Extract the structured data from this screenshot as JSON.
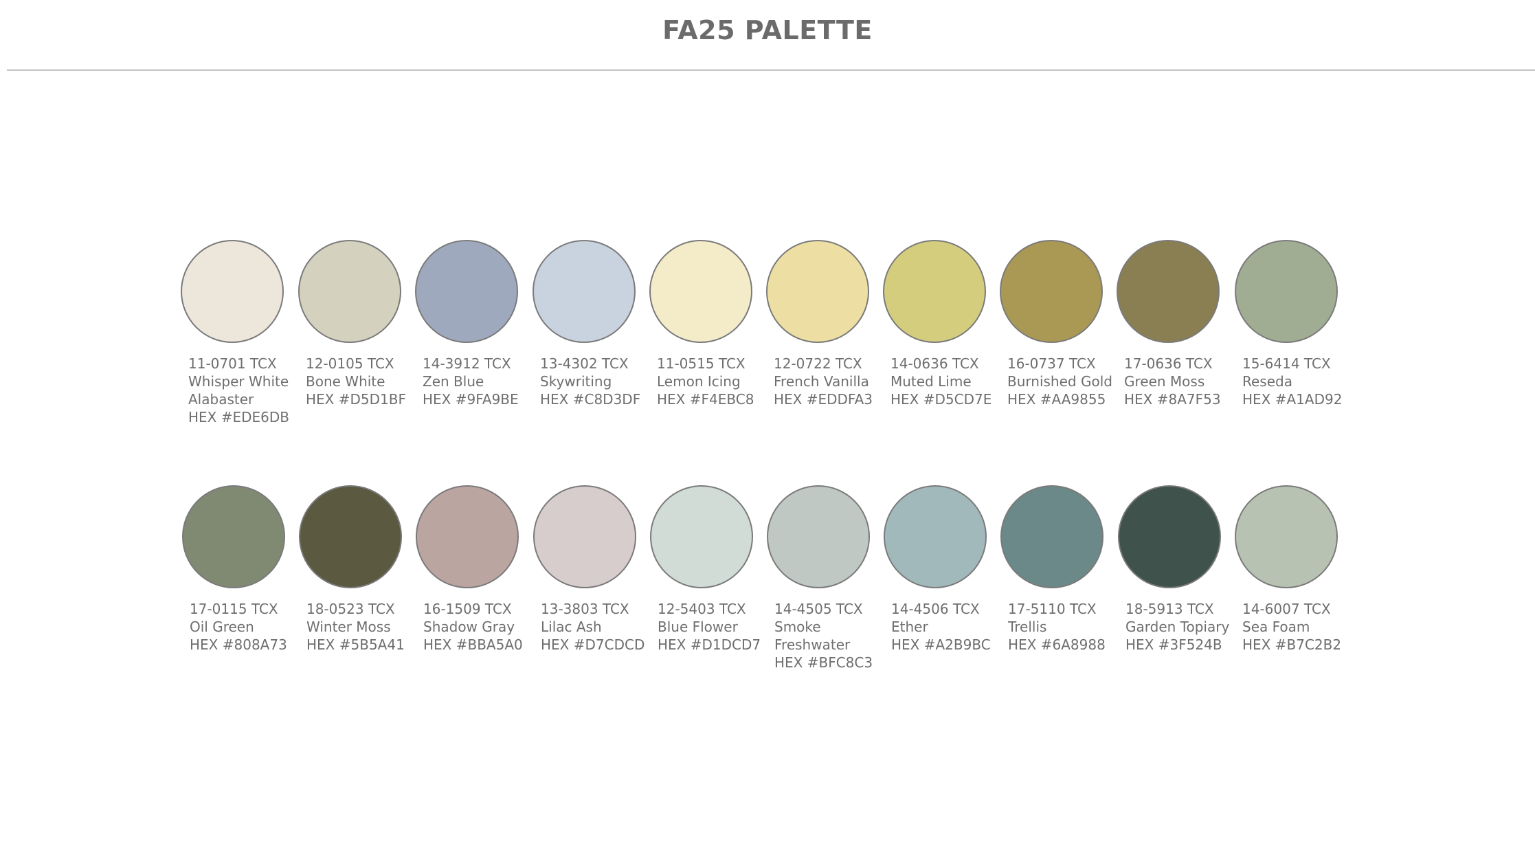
{
  "title": "FA25 PALETTE",
  "rows": [
    {
      "swatches": [
        {
          "code": "11-0701 TCX",
          "name_lines": [
            "Whisper White",
            "Alabaster"
          ],
          "hex_label": "HEX #EDE6DB",
          "color": "#EDE6DB"
        },
        {
          "code": "12-0105 TCX",
          "name_lines": [
            "Bone White"
          ],
          "hex_label": "HEX #D5D1BF",
          "color": "#D5D1BF"
        },
        {
          "code": "14-3912 TCX",
          "name_lines": [
            "Zen Blue"
          ],
          "hex_label": "HEX #9FA9BE",
          "color": "#9FA9BE"
        },
        {
          "code": "13-4302 TCX",
          "name_lines": [
            "Skywriting"
          ],
          "hex_label": "HEX #C8D3DF",
          "color": "#C8D3DF"
        },
        {
          "code": "11-0515 TCX",
          "name_lines": [
            "Lemon Icing"
          ],
          "hex_label": "HEX #F4EBC8",
          "color": "#F4EBC8"
        },
        {
          "code": "12-0722 TCX",
          "name_lines": [
            "French Vanilla"
          ],
          "hex_label": "HEX #EDDFA3",
          "color": "#EDDFA3"
        },
        {
          "code": "14-0636 TCX",
          "name_lines": [
            "Muted Lime"
          ],
          "hex_label": "HEX #D5CD7E",
          "color": "#D5CD7E"
        },
        {
          "code": "16-0737 TCX",
          "name_lines": [
            "Burnished Gold"
          ],
          "hex_label": "HEX #AA9855",
          "color": "#AA9855"
        },
        {
          "code": "17-0636 TCX",
          "name_lines": [
            "Green Moss"
          ],
          "hex_label": "HEX #8A7F53",
          "color": "#8A7F53"
        },
        {
          "code": "15-6414 TCX",
          "name_lines": [
            "Reseda"
          ],
          "hex_label": "HEX #A1AD92",
          "color": "#A1AD92"
        }
      ]
    },
    {
      "swatches": [
        {
          "code": "17-0115 TCX",
          "name_lines": [
            "Oil Green"
          ],
          "hex_label": "HEX #808A73",
          "color": "#808A73"
        },
        {
          "code": "18-0523 TCX",
          "name_lines": [
            "Winter Moss"
          ],
          "hex_label": "HEX #5B5A41",
          "color": "#5B5A41"
        },
        {
          "code": "16-1509 TCX",
          "name_lines": [
            "Shadow Gray"
          ],
          "hex_label": "HEX #BBA5A0",
          "color": "#BBA5A0"
        },
        {
          "code": "13-3803 TCX",
          "name_lines": [
            "Lilac Ash"
          ],
          "hex_label": "HEX #D7CDCD",
          "color": "#D7CDCD"
        },
        {
          "code": "12-5403 TCX",
          "name_lines": [
            "Blue Flower"
          ],
          "hex_label": "HEX #D1DCD7",
          "color": "#D1DCD7"
        },
        {
          "code": "14-4505 TCX",
          "name_lines": [
            "Smoke",
            "Freshwater"
          ],
          "hex_label": "HEX #BFC8C3",
          "color": "#BFC8C3"
        },
        {
          "code": "14-4506 TCX",
          "name_lines": [
            "Ether"
          ],
          "hex_label": "HEX #A2B9BC",
          "color": "#A2B9BC"
        },
        {
          "code": "17-5110 TCX",
          "name_lines": [
            "Trellis"
          ],
          "hex_label": "HEX #6A8988",
          "color": "#6A8988"
        },
        {
          "code": "18-5913 TCX",
          "name_lines": [
            "Garden Topiary"
          ],
          "hex_label": "HEX #3F524B",
          "color": "#3F524B"
        },
        {
          "code": "14-6007 TCX",
          "name_lines": [
            "Sea Foam"
          ],
          "hex_label": "HEX #B7C2B2",
          "color": "#B7C2B2"
        }
      ]
    }
  ]
}
